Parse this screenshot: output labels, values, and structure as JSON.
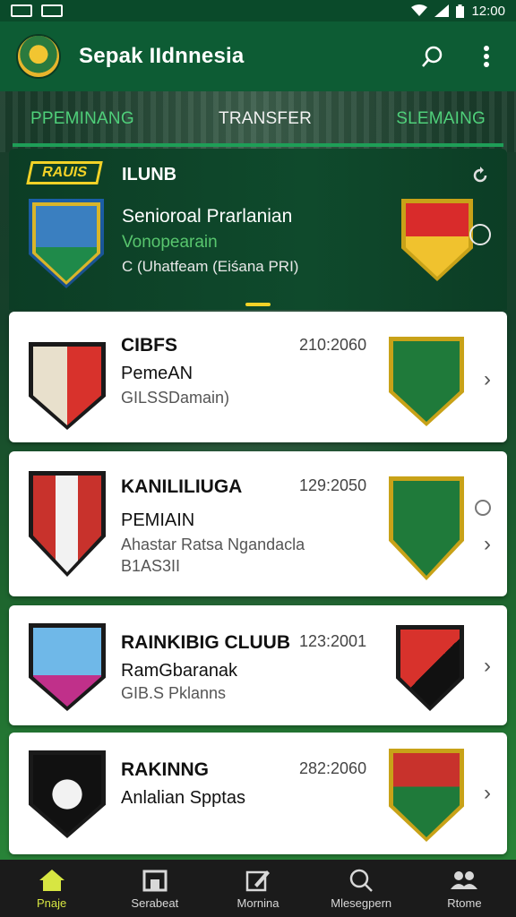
{
  "status_bar": {
    "time": "12:00"
  },
  "app_bar": {
    "title": "Sepak IIdnnesia"
  },
  "tabs": [
    {
      "label": "PPEMINANG"
    },
    {
      "label": "TRANSFER"
    },
    {
      "label": "SLEMAING"
    }
  ],
  "featured": {
    "badge": "RAUIS",
    "label": "ILUNB",
    "name": "Senioroal Prarlanian",
    "subtitle": "Vonopearain",
    "meta": "C (Uhatfeam (Eiśana PRI)"
  },
  "clubs": [
    {
      "title": "CIBFS",
      "line2": "PemeAN",
      "line3": "GILSSDamain)",
      "line4": "",
      "date": "210:2060",
      "trailing": "chevron"
    },
    {
      "title": "KANILILIUGA",
      "line2": "PEMIAIN",
      "line3": "Ahastar Ratsa Ngandacla",
      "line4": "B1AS3II",
      "date": "129:2050",
      "trailing": "radio+chevron"
    },
    {
      "title": "RAINKIBIG CLUUB",
      "line2": "RamGbaranak",
      "line3": "GIB.S Pklanns",
      "line4": "",
      "date": "123:2001",
      "trailing": "chevron"
    },
    {
      "title": "RAKINNG",
      "line2": "Anlalian Spptas",
      "line3": "",
      "line4": "",
      "date": "282:2060",
      "trailing": "chevron"
    }
  ],
  "bottom_nav": [
    {
      "label": "Pnaje",
      "icon": "home-icon",
      "active": true
    },
    {
      "label": "Serabeat",
      "icon": "store-icon",
      "active": false
    },
    {
      "label": "Mornina",
      "icon": "edit-icon",
      "active": false
    },
    {
      "label": "Mlesegpern",
      "icon": "search-icon",
      "active": false
    },
    {
      "label": "Rtome",
      "icon": "people-icon",
      "active": false
    }
  ],
  "colors": {
    "app_bar": "#0d5c34",
    "accent_green": "#4fd07a",
    "accent_yellow": "#f2d227",
    "nav_active": "#d7e642"
  }
}
